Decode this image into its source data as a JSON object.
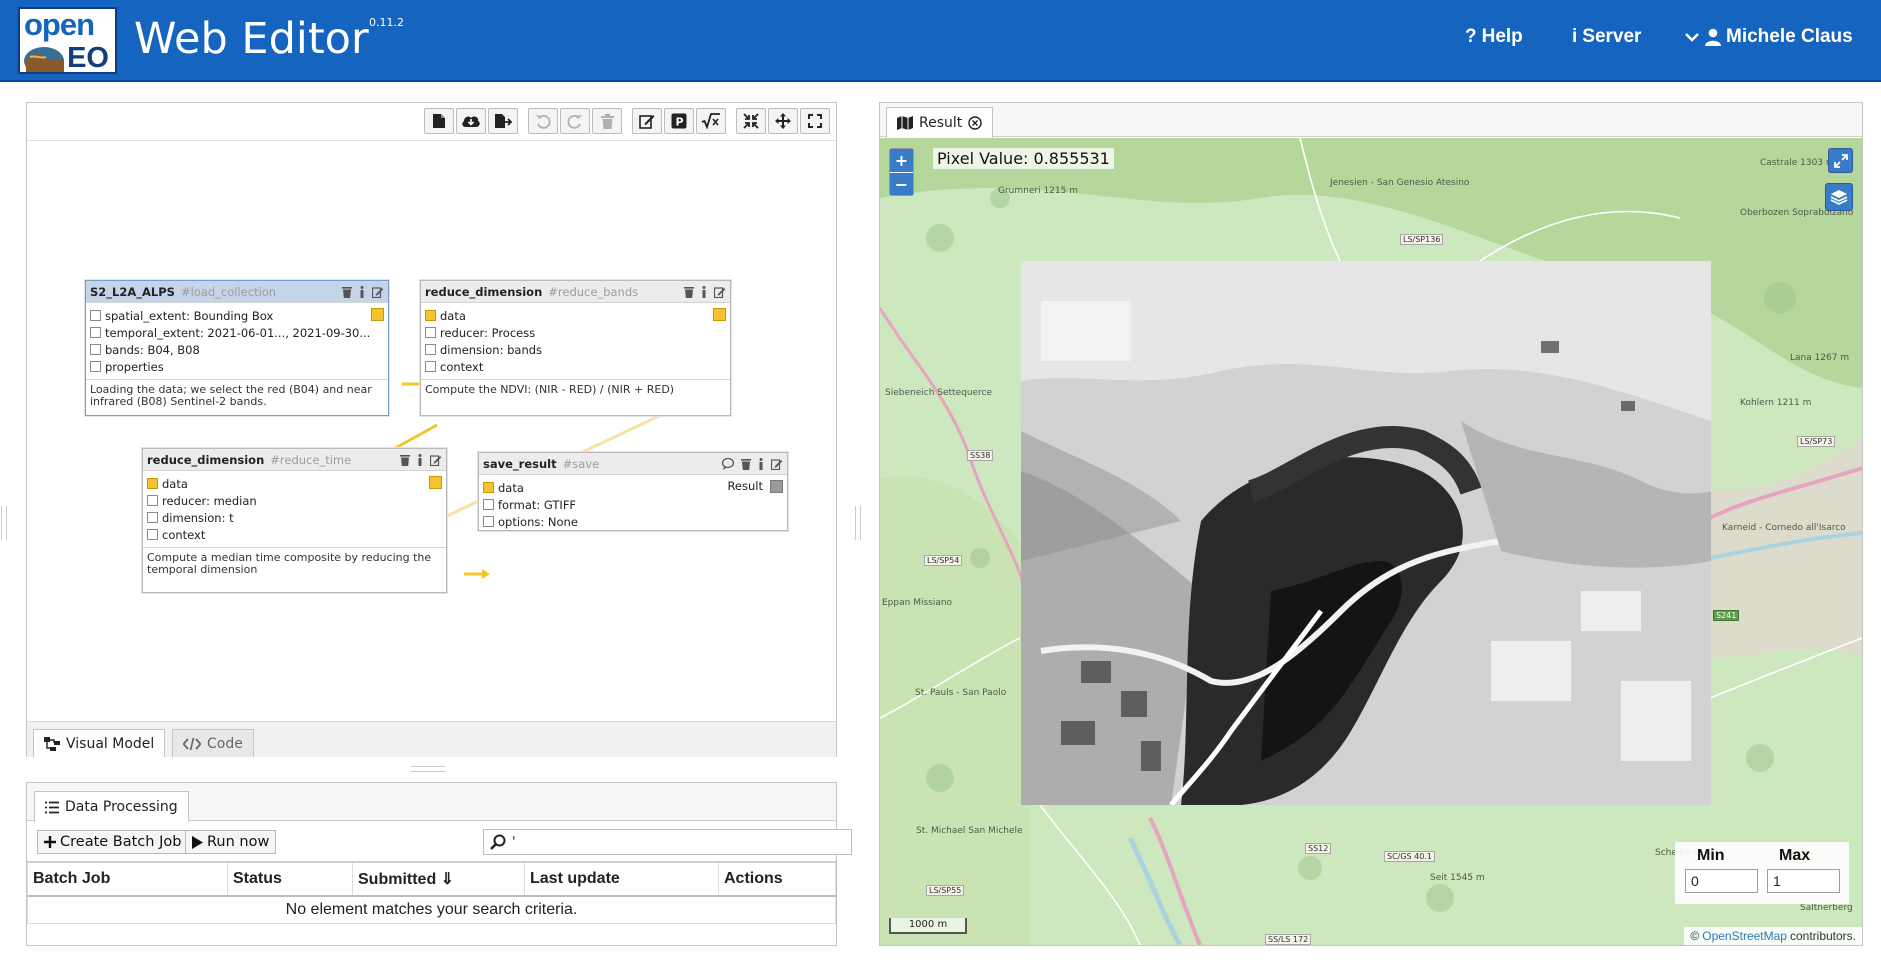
{
  "header": {
    "logo_top": "open",
    "logo_bottom": "EO",
    "title": "Web Editor",
    "version": "0.11.2",
    "nav": {
      "help": "Help",
      "server": "Server",
      "user": "Michele Claus"
    },
    "colors": {
      "bar": "#1565c0"
    }
  },
  "editor": {
    "tabs": [
      {
        "label": "Visual Model",
        "active": true
      },
      {
        "label": "Code",
        "active": false
      }
    ],
    "nodes": [
      {
        "name": "S2_L2A_ALPS",
        "id": "#load_collection",
        "params": [
          "spatial_extent: Bounding Box",
          "temporal_extent: 2021-06-01..., 2021-09-30...",
          "bands: B04, B08",
          "properties"
        ],
        "description": "Loading the data; we select the red (B04) and near infrared (B08) Sentinel-2 bands."
      },
      {
        "name": "reduce_dimension",
        "id": "#reduce_bands",
        "params": [
          "data",
          "reducer: Process",
          "dimension: bands",
          "context"
        ],
        "description": "Compute the NDVI: (NIR - RED) / (NIR + RED)"
      },
      {
        "name": "reduce_dimension",
        "id": "#reduce_time",
        "params": [
          "data",
          "reducer: median",
          "dimension: t",
          "context"
        ],
        "description": "Compute a median time composite by reducing the temporal dimension"
      },
      {
        "name": "save_result",
        "id": "#save",
        "params": [
          "data",
          "format: GTIFF",
          "options: None"
        ],
        "output_label": "Result"
      }
    ]
  },
  "data_processing": {
    "tab_label": "Data Processing",
    "create_batch_job": "Create Batch Job",
    "run_now": "Run now",
    "search_value": "'",
    "columns": [
      "Batch Job",
      "Status",
      "Submitted ⇓",
      "Last update",
      "Actions"
    ],
    "empty_message": "No element matches your search criteria."
  },
  "result": {
    "tab_label": "Result",
    "pixel_value": "Pixel Value: 0.855531",
    "zoom_in": "+",
    "zoom_out": "−",
    "min_label": "Min",
    "max_label": "Max",
    "min_value": "0",
    "max_value": "1",
    "scale_label": "1000 m",
    "attribution_prefix": "©",
    "attribution_link": "OpenStreetMap",
    "attribution_suffix": "contributors.",
    "map_labels": [
      "Jenesien - San Genesio Atesino",
      "Grumneri 1215 m",
      "Oberbozen Soprabolzano",
      "Castrale 1303 m",
      "Siebeneich Settequerce",
      "Karneid - Cornedo all'Isarco",
      "Kohlern 1211 m",
      "Lana 1267 m",
      "St. Pauls - San Paolo",
      "Eppan Missiano",
      "St. Michael San Michele",
      "Seit 1545 m",
      "Scheibe Lind",
      "Saltnerberg"
    ],
    "road_shields": [
      "LS/SP136",
      "LS/SP73",
      "SS38",
      "LS/SP54",
      "S241",
      "SC/GS 40.1",
      "SS12",
      "LS/SP55",
      "SS/LS 172"
    ]
  }
}
